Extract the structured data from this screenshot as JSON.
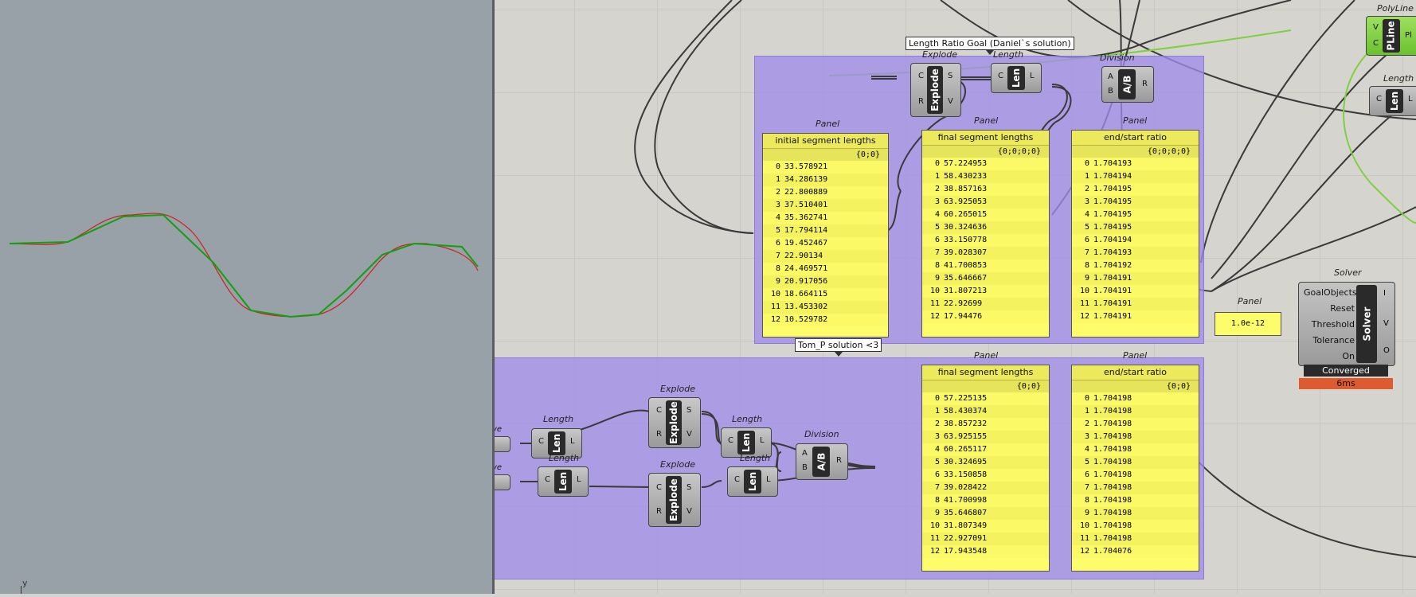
{
  "viewport": {
    "axis_label": "y"
  },
  "groups": {
    "daniel": {
      "label": "Length Ratio Goal (Daniel`s solution)"
    },
    "tom": {
      "label": "Tom_P solution <3"
    }
  },
  "components": {
    "explode": {
      "title": "Explode",
      "core": "Explode",
      "in": [
        "C",
        "R"
      ],
      "out": [
        "S",
        "V"
      ]
    },
    "length": {
      "title": "Length",
      "core": "Len",
      "in": [
        "C"
      ],
      "out": [
        "L"
      ]
    },
    "division": {
      "title": "Division",
      "core": "A/B",
      "in": [
        "A",
        "B"
      ],
      "out": [
        "R"
      ]
    },
    "polyline": {
      "title": "PolyLine",
      "core": "PLine",
      "in": [
        "V",
        "C"
      ],
      "out": [
        "Pl"
      ]
    },
    "curve_stub": {
      "fragment": "ve"
    }
  },
  "panels": {
    "initial": {
      "title": "Panel",
      "header": "initial segment lengths",
      "path": "{0;0}",
      "rows": [
        {
          "i": "0",
          "v": "33.578921"
        },
        {
          "i": "1",
          "v": "34.286139"
        },
        {
          "i": "2",
          "v": "22.800889"
        },
        {
          "i": "3",
          "v": "37.510401"
        },
        {
          "i": "4",
          "v": "35.362741"
        },
        {
          "i": "5",
          "v": "17.794114"
        },
        {
          "i": "6",
          "v": "19.452467"
        },
        {
          "i": "7",
          "v": "22.90134"
        },
        {
          "i": "8",
          "v": "24.469571"
        },
        {
          "i": "9",
          "v": "20.917056"
        },
        {
          "i": "10",
          "v": "18.664115"
        },
        {
          "i": "11",
          "v": "13.453302"
        },
        {
          "i": "12",
          "v": "10.529782"
        }
      ]
    },
    "final_a": {
      "title": "Panel",
      "header": "final segment lengths",
      "path": "{0;0;0;0}",
      "rows": [
        {
          "i": "0",
          "v": "57.224953"
        },
        {
          "i": "1",
          "v": "58.430233"
        },
        {
          "i": "2",
          "v": "38.857163"
        },
        {
          "i": "3",
          "v": "63.925053"
        },
        {
          "i": "4",
          "v": "60.265015"
        },
        {
          "i": "5",
          "v": "30.324636"
        },
        {
          "i": "6",
          "v": "33.150778"
        },
        {
          "i": "7",
          "v": "39.028307"
        },
        {
          "i": "8",
          "v": "41.700853"
        },
        {
          "i": "9",
          "v": "35.646667"
        },
        {
          "i": "10",
          "v": "31.807213"
        },
        {
          "i": "11",
          "v": "22.92699"
        },
        {
          "i": "12",
          "v": "17.94476"
        }
      ]
    },
    "ratio_a": {
      "title": "Panel",
      "header": "end/start ratio",
      "path": "{0;0;0;0}",
      "rows": [
        {
          "i": "0",
          "v": "1.704193"
        },
        {
          "i": "1",
          "v": "1.704194"
        },
        {
          "i": "2",
          "v": "1.704195"
        },
        {
          "i": "3",
          "v": "1.704195"
        },
        {
          "i": "4",
          "v": "1.704195"
        },
        {
          "i": "5",
          "v": "1.704195"
        },
        {
          "i": "6",
          "v": "1.704194"
        },
        {
          "i": "7",
          "v": "1.704193"
        },
        {
          "i": "8",
          "v": "1.704192"
        },
        {
          "i": "9",
          "v": "1.704191"
        },
        {
          "i": "10",
          "v": "1.704191"
        },
        {
          "i": "11",
          "v": "1.704191"
        },
        {
          "i": "12",
          "v": "1.704191"
        }
      ]
    },
    "final_b": {
      "title": "Panel",
      "header": "final segment lengths",
      "path": "{0;0}",
      "rows": [
        {
          "i": "0",
          "v": "57.225135"
        },
        {
          "i": "1",
          "v": "58.430374"
        },
        {
          "i": "2",
          "v": "38.857232"
        },
        {
          "i": "3",
          "v": "63.925155"
        },
        {
          "i": "4",
          "v": "60.265117"
        },
        {
          "i": "5",
          "v": "30.324695"
        },
        {
          "i": "6",
          "v": "33.150858"
        },
        {
          "i": "7",
          "v": "39.028422"
        },
        {
          "i": "8",
          "v": "41.700998"
        },
        {
          "i": "9",
          "v": "35.646807"
        },
        {
          "i": "10",
          "v": "31.807349"
        },
        {
          "i": "11",
          "v": "22.927091"
        },
        {
          "i": "12",
          "v": "17.943548"
        }
      ]
    },
    "ratio_b": {
      "title": "Panel",
      "header": "end/start ratio",
      "path": "{0;0}",
      "rows": [
        {
          "i": "0",
          "v": "1.704198"
        },
        {
          "i": "1",
          "v": "1.704198"
        },
        {
          "i": "2",
          "v": "1.704198"
        },
        {
          "i": "3",
          "v": "1.704198"
        },
        {
          "i": "4",
          "v": "1.704198"
        },
        {
          "i": "5",
          "v": "1.704198"
        },
        {
          "i": "6",
          "v": "1.704198"
        },
        {
          "i": "7",
          "v": "1.704198"
        },
        {
          "i": "8",
          "v": "1.704198"
        },
        {
          "i": "9",
          "v": "1.704198"
        },
        {
          "i": "10",
          "v": "1.704198"
        },
        {
          "i": "11",
          "v": "1.704198"
        },
        {
          "i": "12",
          "v": "1.704076"
        }
      ]
    },
    "threshold": {
      "title": "Panel",
      "value": "1.0e-12"
    }
  },
  "solver": {
    "title": "Solver",
    "core": "Solver",
    "inputs": [
      "GoalObjects",
      "Reset",
      "Threshold",
      "Tolerance",
      "On"
    ],
    "outputs": [
      "I",
      "V",
      "O"
    ],
    "status": "Converged",
    "time": "6ms"
  },
  "colors": {
    "group": "#a08ceb",
    "panel": "#fdfc6b",
    "wire": "#3a3a3a",
    "wire_green": "#7fd040",
    "status_bar": "#e05a30"
  }
}
